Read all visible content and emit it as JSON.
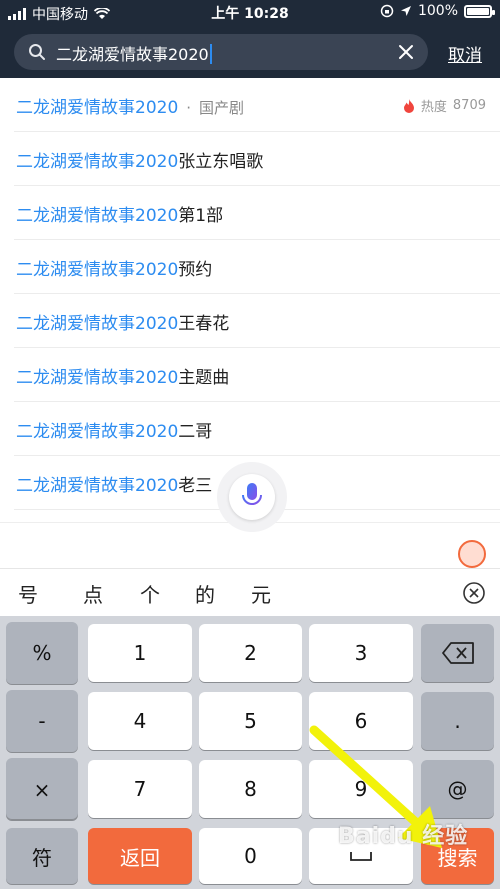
{
  "status": {
    "carrier": "中国移动",
    "time": "上午 10:28",
    "battery": "100%"
  },
  "search": {
    "query": "二龙湖爱情故事2020",
    "cancel_label": "取消"
  },
  "suggestions": [
    {
      "highlight": "二龙湖爱情故事2020",
      "rest": "",
      "tag": "国产剧",
      "heat_label": "热度",
      "heat_value": "8709"
    },
    {
      "highlight": "二龙湖爱情故事2020",
      "rest": "张立东唱歌"
    },
    {
      "highlight": "二龙湖爱情故事2020",
      "rest": "第1部"
    },
    {
      "highlight": "二龙湖爱情故事2020",
      "rest": "预约"
    },
    {
      "highlight": "二龙湖爱情故事2020",
      "rest": "王春花"
    },
    {
      "highlight": "二龙湖爱情故事2020",
      "rest": "主题曲"
    },
    {
      "highlight": "二龙湖爱情故事2020",
      "rest": "二哥"
    },
    {
      "highlight": "二龙湖爱情故事2020",
      "rest": "老三"
    }
  ],
  "candidates": [
    "号",
    "点",
    "个",
    "的",
    "元"
  ],
  "keyboard": {
    "percent": "%",
    "minus": "-",
    "plus": "+",
    "times": "×",
    "symbols": "符",
    "back": "返回",
    "k1": "1",
    "k2": "2",
    "k3": "3",
    "k4": "4",
    "k5": "5",
    "k6": "6",
    "k7": "7",
    "k8": "8",
    "k9": "9",
    "k0": "0",
    "dot": ".",
    "at": "@",
    "search": "搜索"
  },
  "watermark": "Baidu 经验",
  "colors": {
    "header_bg": "#1f2a39",
    "highlight": "#2d8cf0",
    "orange": "#f26a3d",
    "keyboard_bg": "#d1d4da",
    "arrow": "#f2f20a"
  },
  "icons": [
    "signal-icon",
    "wifi-icon",
    "lock-rotation-icon",
    "location-icon",
    "battery-icon",
    "search-icon",
    "clear-icon",
    "flame-icon",
    "microphone-icon",
    "close-circle-icon",
    "backspace-icon",
    "space-icon",
    "arrow-icon"
  ]
}
